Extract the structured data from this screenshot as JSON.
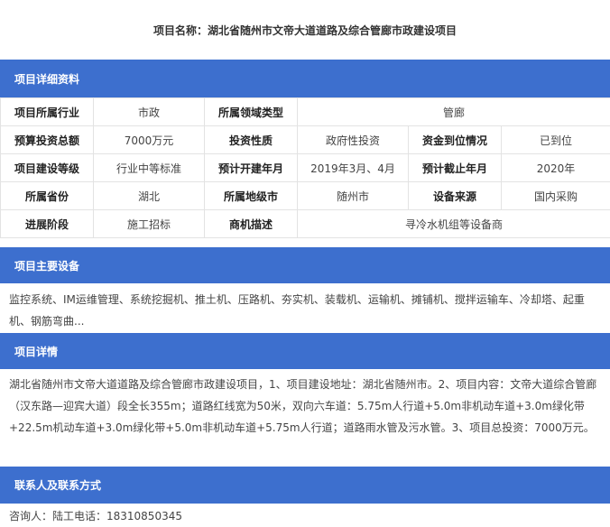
{
  "title": "项目名称：湖北省随州市文帝大道道路及综合管廊市政建设项目",
  "colors": {
    "header_bar": "#3d6fce",
    "border": "#e3e3e3"
  },
  "sections": {
    "details": "项目详细资料",
    "equipment": "项目主要设备",
    "info": "项目详情",
    "contact": "联系人及联系方式"
  },
  "table": {
    "r1": {
      "l1": "项目所属行业",
      "v1": "市政",
      "l2": "所属领域类型",
      "v2": "管廊"
    },
    "r2": {
      "l1": "预算投资总额",
      "v1": "7000万元",
      "l2": "投资性质",
      "v2": "政府性投资",
      "l3": "资金到位情况",
      "v3": "已到位"
    },
    "r3": {
      "l1": "项目建设等级",
      "v1": "行业中等标准",
      "l2": "预计开建年月",
      "v2": "2019年3月、4月",
      "l3": "预计截止年月",
      "v3": "2020年"
    },
    "r4": {
      "l1": "所属省份",
      "v1": "湖北",
      "l2": "所属地级市",
      "v2": "随州市",
      "l3": "设备来源",
      "v3": "国内采购"
    },
    "r5": {
      "l1": "进展阶段",
      "v1": "施工招标",
      "l2": "商机描述",
      "v2": "寻冷水机组等设备商"
    }
  },
  "equipment_text": "监控系统、IM运维管理、系统挖掘机、推土机、压路机、夯实机、装载机、运输机、摊铺机、搅拌运输车、冷却塔、起重机、钢筋弯曲...",
  "detail_text": "湖北省随州市文帝大道道路及综合管廊市政建设项目，1、项目建设地址：湖北省随州市。2、项目内容：文帝大道综合管廊（汉东路—迎宾大道）段全长355m；道路红线宽为50米，双向六车道：5.75m人行道+5.0m非机动车道+3.0m绿化带+22.5m机动车道+3.0m绿化带+5.0m非机动车道+5.75m人行道；道路雨水管及污水管。3、项目总投资：7000万元。",
  "contact_text": "咨询人：陆工电话：18310850345"
}
